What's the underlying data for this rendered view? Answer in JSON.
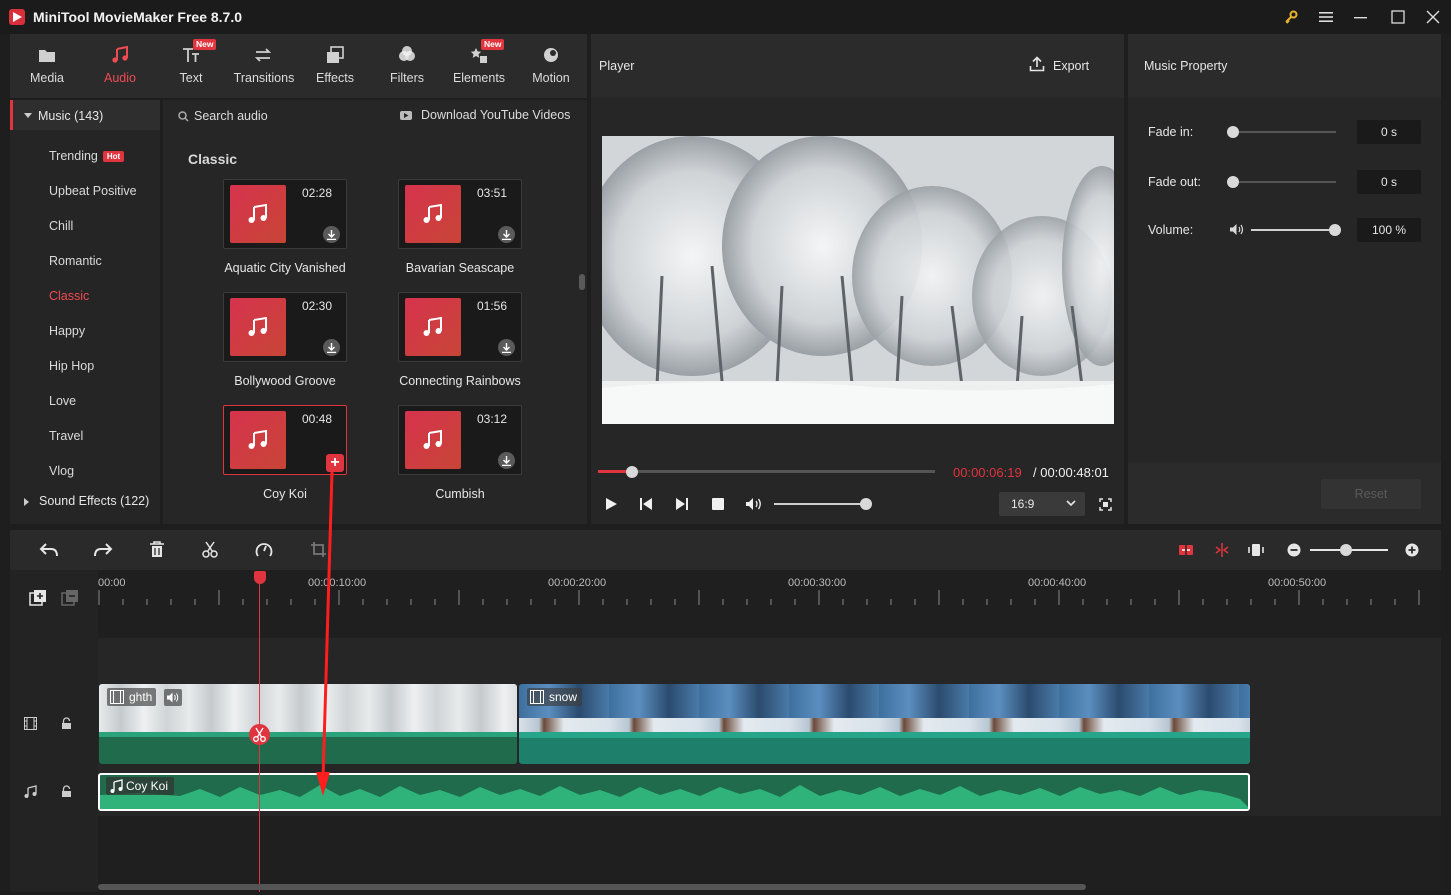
{
  "app": {
    "title": "MiniTool MovieMaker Free 8.7.0"
  },
  "colors": {
    "accent": "#e0343e",
    "audio_clip": "#1f6b4c",
    "waveform": "#2fb37b",
    "playhead": "#e0343e"
  },
  "toolbar": {
    "tabs": [
      {
        "label": "Media",
        "icon": "folder-icon"
      },
      {
        "label": "Audio",
        "icon": "music-note-icon",
        "active": true
      },
      {
        "label": "Text",
        "icon": "text-icon",
        "badge": "New"
      },
      {
        "label": "Transitions",
        "icon": "arrows-swap-icon"
      },
      {
        "label": "Effects",
        "icon": "layers-icon"
      },
      {
        "label": "Filters",
        "icon": "filters-icon"
      },
      {
        "label": "Elements",
        "icon": "elements-icon",
        "badge": "New"
      },
      {
        "label": "Motion",
        "icon": "motion-icon"
      }
    ]
  },
  "sidebar": {
    "music_header": "Music (143)",
    "items": [
      {
        "label": "Trending",
        "badge": "Hot"
      },
      {
        "label": "Upbeat Positive"
      },
      {
        "label": "Chill"
      },
      {
        "label": "Romantic"
      },
      {
        "label": "Classic",
        "active": true
      },
      {
        "label": "Happy"
      },
      {
        "label": "Hip Hop"
      },
      {
        "label": "Love"
      },
      {
        "label": "Travel"
      },
      {
        "label": "Vlog"
      }
    ],
    "sound_effects": "Sound Effects (122)"
  },
  "library": {
    "search_placeholder": "Search audio",
    "download_link": "Download YouTube Videos",
    "section_title": "Classic",
    "tracks": [
      {
        "name": "Aquatic City Vanished",
        "duration": "02:28"
      },
      {
        "name": "Bavarian Seascape",
        "duration": "03:51"
      },
      {
        "name": "Bollywood Groove",
        "duration": "02:30"
      },
      {
        "name": "Connecting Rainbows",
        "duration": "01:56"
      },
      {
        "name": "Coy Koi",
        "duration": "00:48",
        "selected": true
      },
      {
        "name": "Cumbish",
        "duration": "03:12"
      }
    ]
  },
  "player": {
    "title": "Player",
    "export_label": "Export",
    "current_time": "00:00:06:19",
    "total_time": "/ 00:00:48:01",
    "progress_fraction": 0.102,
    "aspect": "16:9",
    "volume_fraction": 1.0
  },
  "property": {
    "title": "Music Property",
    "fade_in_label": "Fade in:",
    "fade_in_value": "0 s",
    "fade_out_label": "Fade out:",
    "fade_out_value": "0 s",
    "volume_label": "Volume:",
    "volume_value": "100 %",
    "reset_label": "Reset"
  },
  "timeline": {
    "ruler": [
      "00:00",
      "00:00:10:00",
      "00:00:20:00",
      "00:00:30:00",
      "00:00:40:00",
      "00:00:50:00"
    ],
    "video_clips": [
      {
        "name": "ghth"
      },
      {
        "name": "snow"
      }
    ],
    "audio_clip": {
      "name": "Coy Koi"
    }
  }
}
